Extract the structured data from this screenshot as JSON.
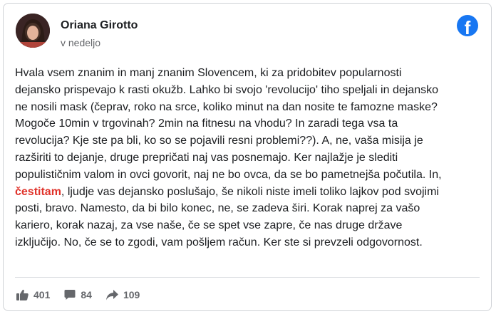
{
  "post": {
    "author": "Oriana Girotto",
    "time": "v nedeljo",
    "lines": [
      {
        "pre": "Hvala vsem znanim in manj znanim Slovencem, ki za pridobitev popularnosti"
      },
      {
        "pre": "dejansko prispevajo k rasti okužb. Lahko bi svojo 'revolucijo' tiho speljali in dejansko"
      },
      {
        "pre": "ne nosili mask (čeprav, roko na srce, koliko minut na dan nosite te famozne maske?"
      },
      {
        "pre": "Mogoče 10min v trgovinah? 2min na fitnesu na vhodu? In zaradi tega vsa ta"
      },
      {
        "pre": "revolucija? Kje ste pa bli, ko so se pojavili resni problemi??). A, ne, vaša misija je"
      },
      {
        "pre": "razširiti to dejanje, druge prepričati naj vas posnemajo. Ker najlažje je slediti"
      },
      {
        "pre": "populističnim valom in ovci govorit, naj ne bo ovca, da se bo pametnejša počutila. In,"
      },
      {
        "pre": "",
        "highlight": "čestitam",
        "post": ", ljudje vas dejansko poslušajo, še nikoli niste imeli toliko lajkov pod svojimi"
      },
      {
        "pre": "posti, bravo. Namesto, da bi bilo konec, ne, se zadeva širi. Korak naprej za vašo"
      },
      {
        "pre": "kariero, korak nazaj, za vse naše, če se spet vse zapre, če nas druge države"
      },
      {
        "pre": "izključijo. No, če se to zgodi, vam pošljem račun. Ker ste si prevzeli odgovornost."
      }
    ],
    "likes": "401",
    "comments": "84",
    "shares": "109",
    "brand_icon": "facebook-logo-icon",
    "brand_letter": "f",
    "colors": {
      "accent": "#1877f2",
      "highlight": "#e0332b",
      "muted": "#65676b"
    }
  }
}
